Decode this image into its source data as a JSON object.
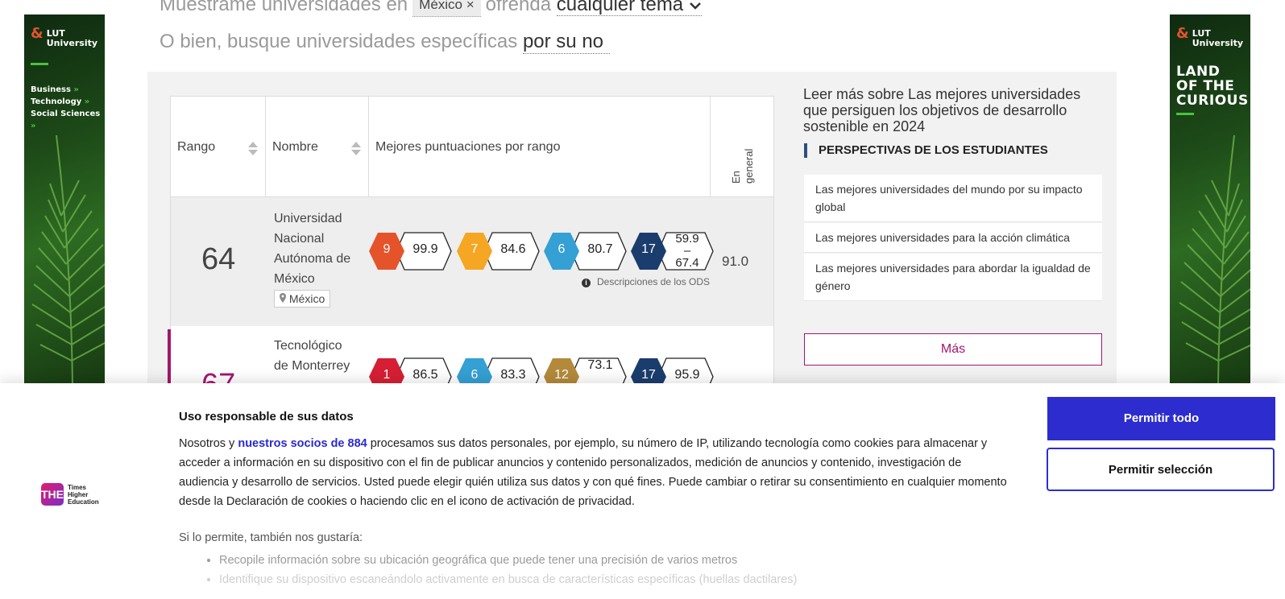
{
  "ad_left": {
    "logo_line1": "LUT",
    "logo_line2": "University",
    "links": [
      "Business",
      "Technology",
      "Social Sciences"
    ],
    "arrow": "»"
  },
  "ad_right": {
    "logo_line1": "LUT",
    "logo_line2": "University",
    "tagline": [
      "LAND",
      "OF THE",
      "CURIOUS"
    ]
  },
  "search": {
    "prefix": "Muéstrame universidades en",
    "country_chip": "México ×",
    "middle": "ofrenda",
    "topic": "cualquier tema",
    "line2_prefix": "O bien, busque universidades específicas",
    "name_input": "por su no"
  },
  "table": {
    "headers": {
      "rank": "Rango",
      "name": "Nombre",
      "scores": "Mejores puntuaciones por rango",
      "overall": [
        "En",
        "general"
      ]
    },
    "rows": [
      {
        "rank": "64",
        "name_lines": [
          "Universidad",
          "Nacional",
          "Autónoma de",
          "México"
        ],
        "location": "México",
        "scores": [
          {
            "sdg": "9",
            "value": "99.9",
            "color": "#e5532b"
          },
          {
            "sdg": "7",
            "value": "84.6",
            "color": "#f5a623"
          },
          {
            "sdg": "6",
            "value": "80.7",
            "color": "#35a0d3"
          },
          {
            "sdg": "17",
            "value_top": "59.9",
            "value_mid": "–",
            "value_bot": "67.4",
            "color": "#1b3d6d"
          }
        ],
        "overall": "91.0"
      },
      {
        "rank": "67",
        "name_lines": [
          "Tecnológico",
          "de Monterrey"
        ],
        "scores": [
          {
            "sdg": "1",
            "value": "86.5",
            "color": "#d61f35"
          },
          {
            "sdg": "6",
            "value": "83.3",
            "color": "#35a0d3"
          },
          {
            "sdg": "12",
            "value": "73.1",
            "color": "#b48a3a"
          },
          {
            "sdg": "17",
            "value": "95.9",
            "color": "#1b3d6d"
          }
        ]
      }
    ],
    "ods_note": "Descripciones de los ODS"
  },
  "sidebar": {
    "title": "Leer más sobre Las mejores universidades que persiguen los objetivos de desarrollo sostenible en 2024",
    "section": "PERSPECTIVAS DE LOS ESTUDIANTES",
    "items": [
      "Las mejores universidades del mundo por su impacto global",
      "Las mejores universidades para la acción climática",
      "Las mejores universidades para abordar la igualdad de género"
    ],
    "more": "Más"
  },
  "consent": {
    "logo_box": "THE",
    "logo_text": [
      "Times",
      "Higher",
      "Education"
    ],
    "title": "Uso responsable de sus datos",
    "body_prefix": "Nosotros y ",
    "body_link": "nuestros socios de 884",
    "body_rest": " procesamos sus datos personales, por ejemplo, su número de IP, utilizando tecnología como cookies para almacenar y acceder a información en su dispositivo con el fin de publicar anuncios y contenido personalizados, medición de anuncios y contenido, investigación de audiencia y desarrollo de servicios. Usted puede elegir quién utiliza sus datos y con qué fines. Puede cambiar o retirar su consentimiento en cualquier momento desde la Declaración de cookies o haciendo clic en el icono de activación de privacidad.",
    "also": "Si lo permite, también nos gustaría:",
    "list": [
      "Recopile información sobre su ubicación geográfica que puede tener una precisión de varios metros",
      "Identifique su dispositivo escaneándolo activamente en busca de características específicas (huellas dactilares)"
    ],
    "allow_all": "Permitir todo",
    "allow_selection": "Permitir selección"
  }
}
